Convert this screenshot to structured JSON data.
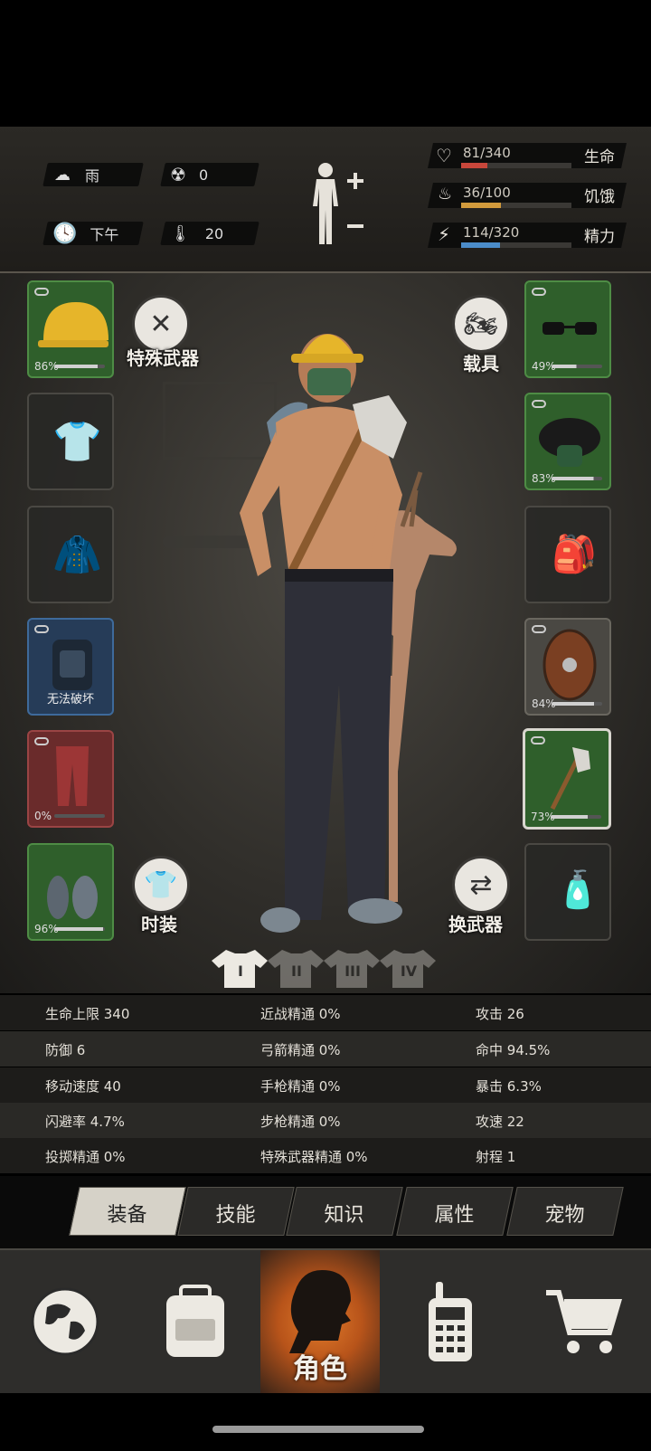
{
  "hud": {
    "weather_label": "雨",
    "radiation": "0",
    "time_label": "下午",
    "temperature": "20",
    "health": {
      "text": "81/340",
      "label": "生命",
      "fraction": 0.238,
      "color": "#c8473b"
    },
    "hunger": {
      "text": "36/100",
      "label": "饥饿",
      "fraction": 0.36,
      "color": "#d19a3c"
    },
    "energy": {
      "text": "114/320",
      "label": "精力",
      "fraction": 0.356,
      "color": "#4b8cc9"
    }
  },
  "equipment": {
    "left": [
      {
        "name": "helmet",
        "pct": "86%",
        "durability": 0.86
      },
      {
        "name": "shirt"
      },
      {
        "name": "coat"
      },
      {
        "name": "backpack",
        "note": "无法破坏"
      },
      {
        "name": "pants",
        "pct": "0%",
        "durability": 0.0
      },
      {
        "name": "shoes",
        "pct": "96%",
        "durability": 0.96
      }
    ],
    "right": [
      {
        "name": "glasses",
        "pct": "49%",
        "durability": 0.49
      },
      {
        "name": "gas-mask",
        "pct": "83%",
        "durability": 0.83
      },
      {
        "name": "bag"
      },
      {
        "name": "shield",
        "pct": "84%",
        "durability": 0.84
      },
      {
        "name": "axe",
        "pct": "73%",
        "durability": 0.73
      },
      {
        "name": "bottle"
      }
    ],
    "special_weapon_label": "特殊武器",
    "vehicle_label": "载具",
    "fashion_label": "时装",
    "swap_weapon_label": "换武器",
    "outfit_tabs": [
      "I",
      "II",
      "III",
      "IV"
    ]
  },
  "stats": [
    [
      "生命上限 340",
      "近战精通 0%",
      "攻击 26"
    ],
    [
      "防御 6",
      "弓箭精通 0%",
      "命中 94.5%"
    ],
    [
      "移动速度 40",
      "手枪精通 0%",
      "暴击 6.3%"
    ],
    [
      "闪避率 4.7%",
      "步枪精通 0%",
      "攻速 22"
    ],
    [
      "投掷精通 0%",
      "特殊武器精通 0%",
      "射程 1"
    ]
  ],
  "tabs": [
    "装备",
    "技能",
    "知识",
    "属性",
    "宠物"
  ],
  "nav": {
    "character_label": "角色"
  }
}
